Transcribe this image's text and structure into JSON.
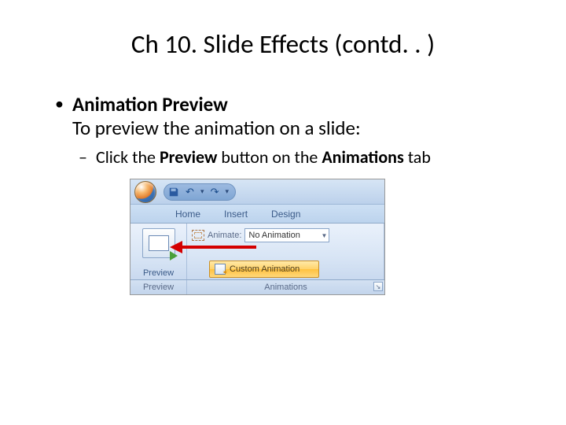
{
  "title": "Ch 10. Slide Effects (contd. . )",
  "bullet1_heading": "Animation Preview",
  "bullet1_body": "To preview the animation on a slide:",
  "sub_prefix": "Click the ",
  "sub_bold1": "Preview ",
  "sub_mid": "button on the ",
  "sub_bold2": "Animations ",
  "sub_suffix": "tab",
  "ribbon": {
    "tabs": {
      "home": "Home",
      "insert": "Insert",
      "design": "Design"
    },
    "preview_group": {
      "button_label": "Preview",
      "title": "Preview"
    },
    "anim_group": {
      "animate_label": "Animate:",
      "animate_value": "No Animation",
      "custom_label": "Custom Animation",
      "title": "Animations"
    }
  }
}
